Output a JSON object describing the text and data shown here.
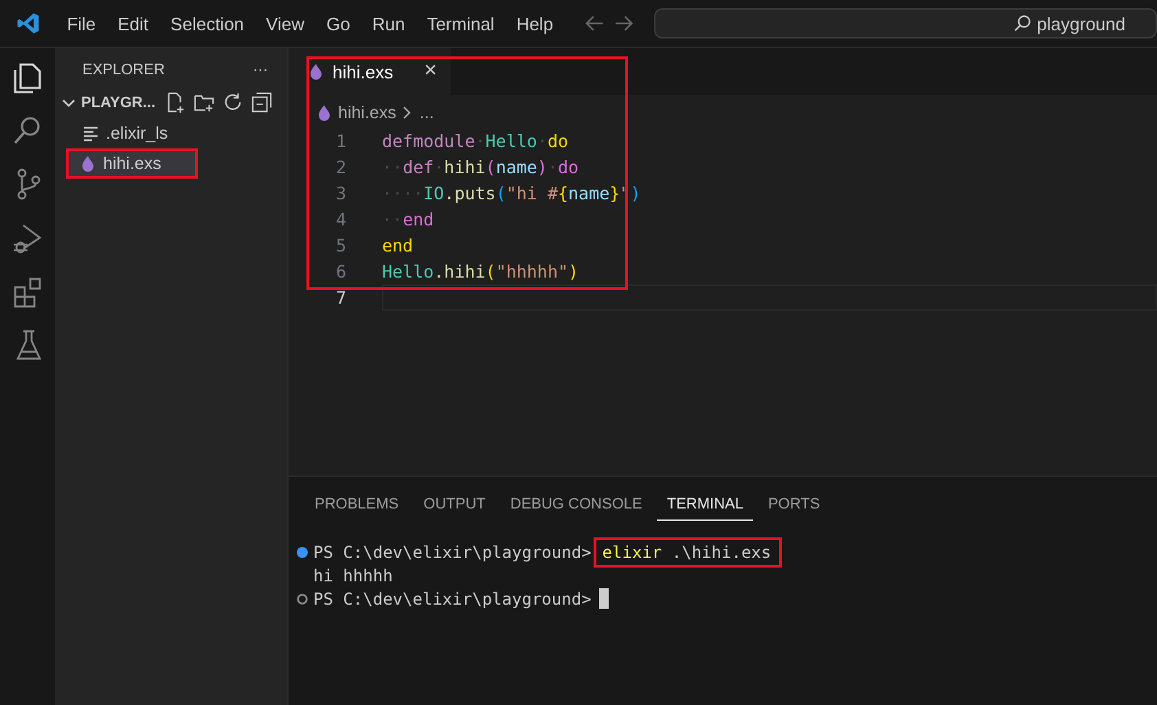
{
  "menu": [
    "File",
    "Edit",
    "Selection",
    "View",
    "Go",
    "Run",
    "Terminal",
    "Help"
  ],
  "command_center": {
    "value": "playground"
  },
  "activity_bar": [
    {
      "kind": "explorer",
      "selected": true
    },
    {
      "kind": "search",
      "selected": false
    },
    {
      "kind": "source-control",
      "selected": false
    },
    {
      "kind": "run-debug",
      "selected": false
    },
    {
      "kind": "extensions",
      "selected": false
    },
    {
      "kind": "testing",
      "selected": false
    }
  ],
  "sidebar": {
    "title": "EXPLORER",
    "more": "···",
    "folder": {
      "name": "PLAYGR...",
      "expanded": true
    },
    "files": [
      {
        "name": ".elixir_ls",
        "kind": "folder-file",
        "selected": false,
        "highlighted": false
      },
      {
        "name": "hihi.exs",
        "kind": "elixir",
        "selected": true,
        "highlighted": true
      }
    ]
  },
  "editor": {
    "tabs": [
      {
        "label": "hihi.exs",
        "selected": true,
        "close": "×"
      }
    ],
    "breadcrumb": [
      "hihi.exs",
      "..."
    ],
    "lines": [
      {
        "number": "1",
        "tokens": [
          {
            "text": "defmodule",
            "color": "#c586c0"
          },
          {
            "text": "·",
            "color": "#4a4a4a"
          },
          {
            "text": "Hello",
            "color": "#4ec9b0"
          },
          {
            "text": "·",
            "color": "#4a4a4a"
          },
          {
            "text": "do",
            "color": "#ffd700"
          }
        ]
      },
      {
        "number": "2",
        "tokens": [
          {
            "text": "··",
            "color": "#4a4a4a"
          },
          {
            "text": "def",
            "color": "#c586c0"
          },
          {
            "text": "·",
            "color": "#4a4a4a"
          },
          {
            "text": "hihi",
            "color": "#dcdcaa"
          },
          {
            "text": "(",
            "color": "#da70d6"
          },
          {
            "text": "name",
            "color": "#9cdcfe"
          },
          {
            "text": ")",
            "color": "#da70d6"
          },
          {
            "text": "·",
            "color": "#4a4a4a"
          },
          {
            "text": "do",
            "color": "#da70d6"
          }
        ]
      },
      {
        "number": "3",
        "tokens": [
          {
            "text": "····",
            "color": "#4a4a4a"
          },
          {
            "text": "IO",
            "color": "#4ec9b0"
          },
          {
            "text": ".puts",
            "color": "#dcdcaa"
          },
          {
            "text": "(",
            "color": "#179fff"
          },
          {
            "text": "\"hi #",
            "color": "#ce9178"
          },
          {
            "text": "{",
            "color": "#ffd700"
          },
          {
            "text": "name",
            "color": "#9cdcfe"
          },
          {
            "text": "}",
            "color": "#ffd700"
          },
          {
            "text": "\"",
            "color": "#ce9178"
          },
          {
            "text": ")",
            "color": "#179fff"
          }
        ]
      },
      {
        "number": "4",
        "tokens": [
          {
            "text": "··",
            "color": "#4a4a4a"
          },
          {
            "text": "end",
            "color": "#da70d6"
          }
        ]
      },
      {
        "number": "5",
        "tokens": [
          {
            "text": "end",
            "color": "#ffd700"
          }
        ]
      },
      {
        "number": "6",
        "tokens": [
          {
            "text": "Hello",
            "color": "#4ec9b0"
          },
          {
            "text": ".hihi",
            "color": "#dcdcaa"
          },
          {
            "text": "(",
            "color": "#ffd700"
          },
          {
            "text": "\"hhhhh\"",
            "color": "#ce9178"
          },
          {
            "text": ")",
            "color": "#ffd700"
          }
        ]
      },
      {
        "number": "7",
        "current": true
      }
    ]
  },
  "panel": {
    "tabs": [
      {
        "label": "PROBLEMS",
        "selected": false
      },
      {
        "label": "OUTPUT",
        "selected": false
      },
      {
        "label": "DEBUG CONSOLE",
        "selected": false
      },
      {
        "label": "TERMINAL",
        "selected": true
      },
      {
        "label": "PORTS",
        "selected": false
      }
    ],
    "terminal": [
      {
        "kind": "prompt",
        "finished": true,
        "prompt": "PS C:\\dev\\elixir\\playground>",
        "command": "elixir",
        "args": " .\\hihi.exs",
        "highlighted": true
      },
      {
        "kind": "output",
        "text": "hi hhhhh"
      },
      {
        "kind": "prompt",
        "finished": false,
        "prompt": "PS C:\\dev\\elixir\\playground>",
        "cursor": true
      }
    ]
  }
}
